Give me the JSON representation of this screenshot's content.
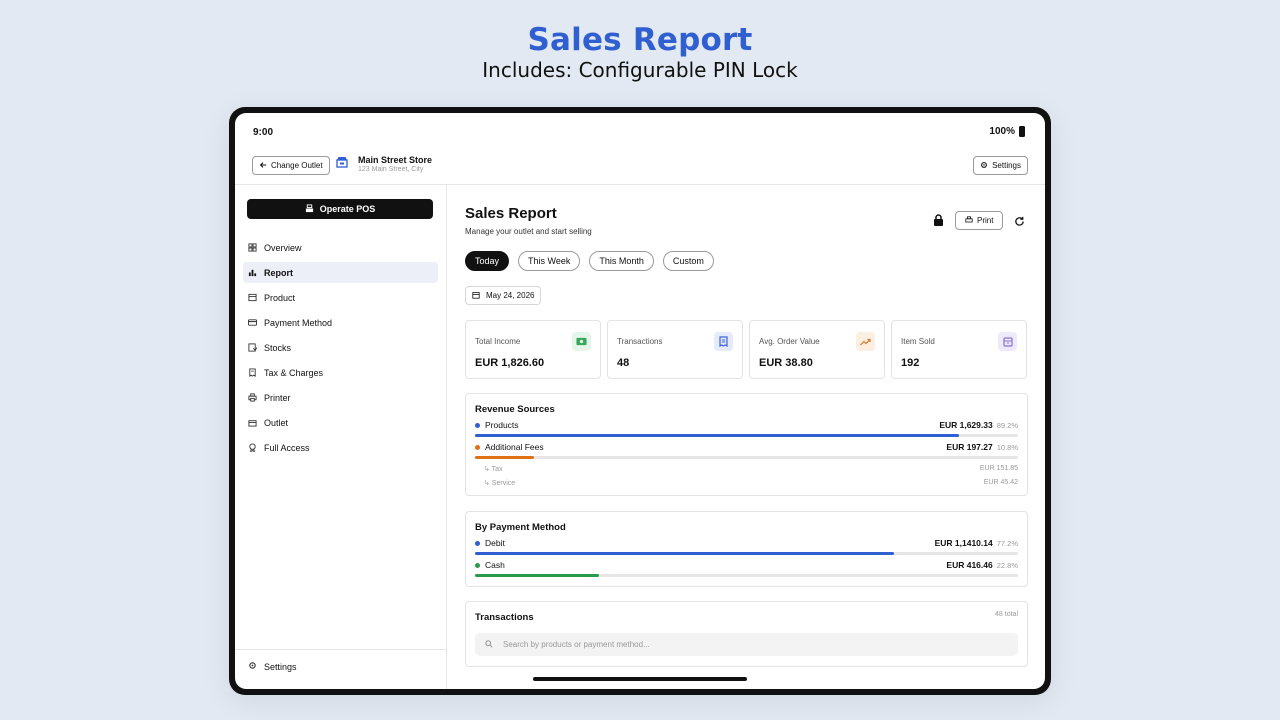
{
  "hero": {
    "title": "Sales Report",
    "subtitle": "Includes: Configurable PIN Lock"
  },
  "status_bar": {
    "time": "9:00",
    "battery": "100%"
  },
  "header": {
    "change_outlet": "Change Outlet",
    "store_name": "Main Street Store",
    "store_address": "123 Main Street, City",
    "settings": "Settings"
  },
  "sidebar": {
    "operate_pos": "Operate POS",
    "items": [
      {
        "label": "Overview",
        "icon": "grid-icon"
      },
      {
        "label": "Report",
        "icon": "bar-chart-icon",
        "active": true
      },
      {
        "label": "Product",
        "icon": "box-icon"
      },
      {
        "label": "Payment Method",
        "icon": "card-icon"
      },
      {
        "label": "Stocks",
        "icon": "stock-icon"
      },
      {
        "label": "Tax & Charges",
        "icon": "receipt-icon"
      },
      {
        "label": "Printer",
        "icon": "printer-icon"
      },
      {
        "label": "Outlet",
        "icon": "store-icon"
      },
      {
        "label": "Full Access",
        "icon": "badge-icon"
      }
    ],
    "settings": "Settings"
  },
  "main": {
    "title": "Sales Report",
    "subtitle": "Manage your outlet and start selling",
    "print": "Print",
    "filters": [
      {
        "label": "Today",
        "active": true
      },
      {
        "label": "This Week"
      },
      {
        "label": "This Month"
      },
      {
        "label": "Custom"
      }
    ],
    "date": "May 24, 2026",
    "stats": [
      {
        "label": "Total Income",
        "value": "EUR 1,826.60",
        "icon": "cash-icon",
        "color": "#3aa55d",
        "bg": "#e4f5e9"
      },
      {
        "label": "Transactions",
        "value": "48",
        "icon": "receipt-icon",
        "color": "#3b63d6",
        "bg": "#e5ebfb"
      },
      {
        "label": "Avg. Order Value",
        "value": "EUR 38.80",
        "icon": "trend-up-icon",
        "color": "#e0782a",
        "bg": "#fdeee2"
      },
      {
        "label": "Item Sold",
        "value": "192",
        "icon": "archive-icon",
        "color": "#8a6fd6",
        "bg": "#efeafb"
      }
    ],
    "revenue_sources": {
      "title": "Revenue Sources",
      "rows": [
        {
          "label": "Products",
          "value": "EUR 1,629.33",
          "pct": "89.2%",
          "fraction": 0.892,
          "color": "#2f5fd0"
        },
        {
          "label": "Additional Fees",
          "value": "EUR 197.27",
          "pct": "10.8%",
          "fraction": 0.108,
          "color": "#e07014"
        }
      ],
      "sub_rows": [
        {
          "label": "↳ Tax",
          "value": "EUR 151.85"
        },
        {
          "label": "↳ Service",
          "value": "EUR 45.42"
        }
      ]
    },
    "payment_methods": {
      "title": "By Payment Method",
      "rows": [
        {
          "label": "Debit",
          "value": "EUR 1,1410.14",
          "pct": "77.2%",
          "fraction": 0.772,
          "color": "#2f5fd0"
        },
        {
          "label": "Cash",
          "value": "EUR 416.46",
          "pct": "22.8%",
          "fraction": 0.228,
          "color": "#2a9a4d"
        }
      ]
    },
    "transactions": {
      "title": "Transactions",
      "count": "48 total",
      "search_placeholder": "Search by products or payment method..."
    }
  }
}
